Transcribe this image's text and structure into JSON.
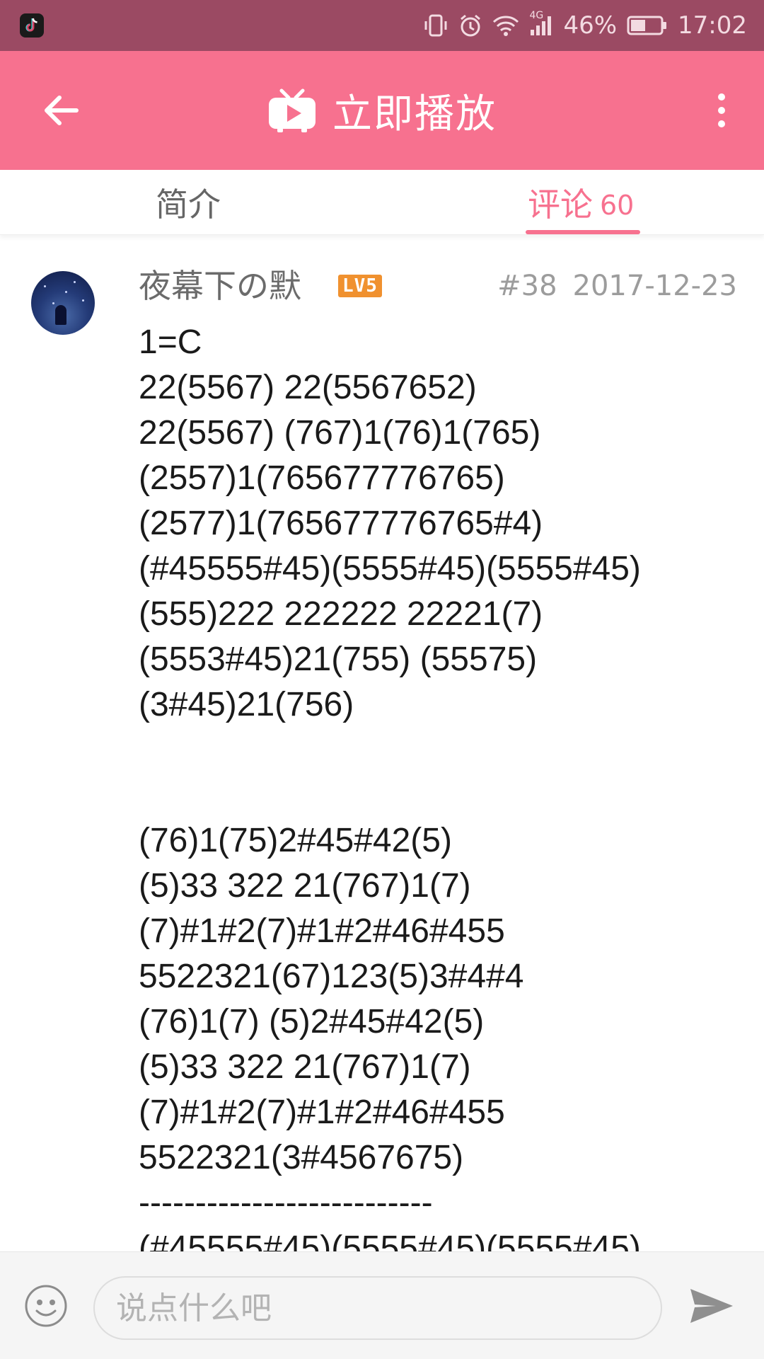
{
  "status_bar": {
    "app_icon": "tiktok-icon",
    "icons": [
      "vibrate-icon",
      "alarm-icon",
      "wifi-icon",
      "signal-4g-icon",
      "battery-icon"
    ],
    "network": "4G",
    "battery": "46%",
    "time": "17:02"
  },
  "app_bar": {
    "back_icon": "arrow-left-icon",
    "title_icon": "tv-play-icon",
    "title": "立即播放",
    "menu_icon": "more-vertical-icon"
  },
  "tabs": {
    "intro_label": "简介",
    "comments_label": "评论",
    "comments_count": "60",
    "active": "comments"
  },
  "comment": {
    "username": "夜幕下の默",
    "level": "LV5",
    "floor": "#38",
    "date": "2017-12-23",
    "body": "1=C\n22(5567) 22(5567652)\n22(5567) (767)1(76)1(765)\n(2557)1(765677776765)\n(2577)1(765677776765#4)\n(#45555#45)(5555#45)(5555#45)\n(555)222 222222 22221(7)\n(5553#45)21(755) (55575)\n(3#45)21(756)\n\n\n(76)1(75)2#45#42(5)\n(5)33 322 21(767)1(7)\n(7)#1#2(7)#1#2#46#455\n5522321(67)123(5)3#4#4\n(76)1(7) (5)2#45#42(5)\n(5)33 322 21(767)1(7)\n(7)#1#2(7)#1#2#46#455\n5522321(3#4567675)\n--------------------------\n(#45555#45)(5555#45)(5555#45)"
  },
  "bottom_bar": {
    "emoji_icon": "emoji-icon",
    "input_placeholder": "说点什么吧",
    "input_value": "",
    "send_icon": "send-icon"
  },
  "colors": {
    "status_bar": "#9b4a63",
    "app_bar": "#f7718f",
    "accent": "#f7718f",
    "level_badge": "#f0912f"
  }
}
